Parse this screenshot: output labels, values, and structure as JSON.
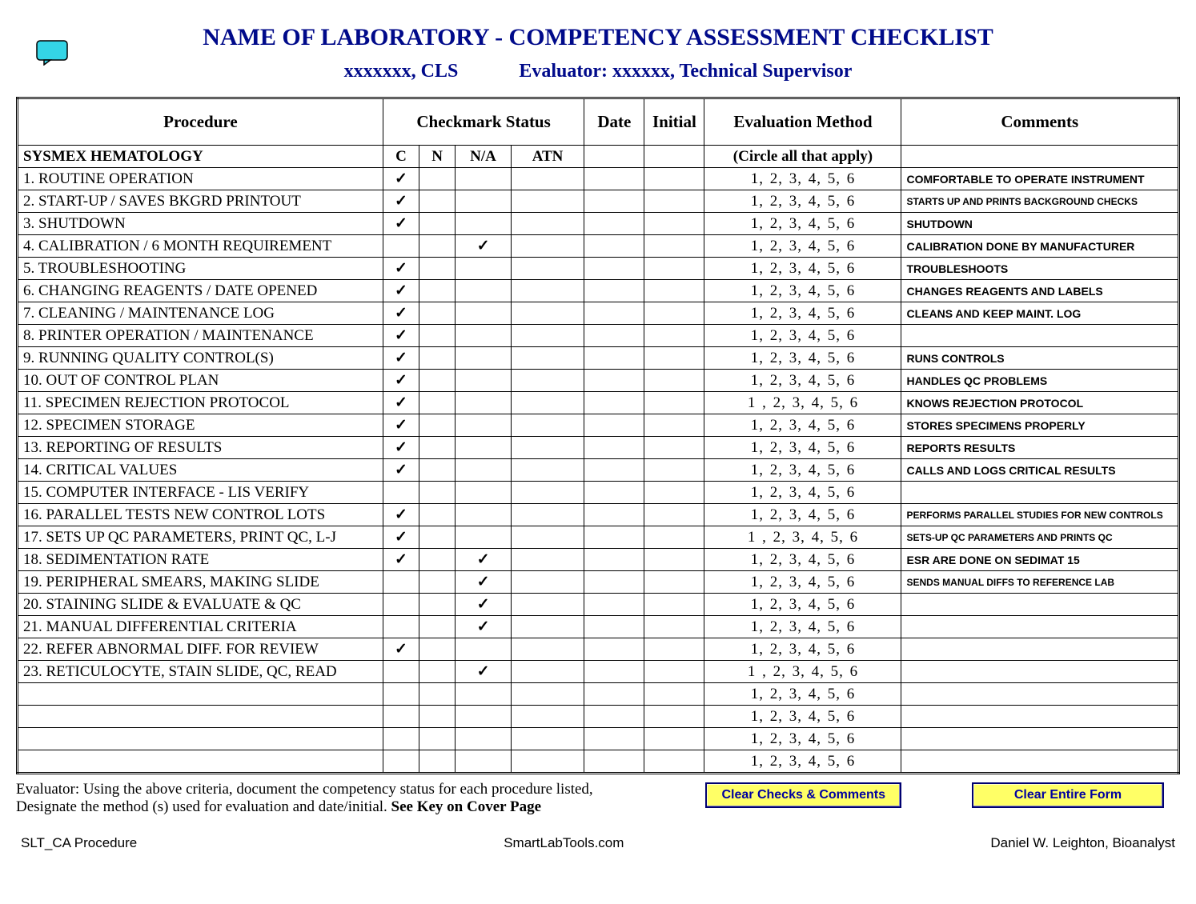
{
  "title": "NAME OF LABORATORY - COMPETENCY ASSESSMENT CHECKLIST",
  "subtitle": {
    "person": "xxxxxxx, CLS",
    "evaluator": "Evaluator: xxxxxx, Technical Supervisor"
  },
  "columns": {
    "procedure": "Procedure",
    "checkmark_status": "Checkmark Status",
    "date": "Date",
    "initial": "Initial",
    "eval_method": "Evaluation Method",
    "comments": "Comments"
  },
  "subheader": {
    "procedure": "SYSMEX HEMATOLOGY",
    "c": "C",
    "n": "N",
    "na": "N/A",
    "atn": "ATN",
    "eval": "(Circle all that apply)"
  },
  "eval_numbers": "1,   2,   3,   4,   5,   6",
  "eval_numbers_spaced": "1 ,  2,   3,   4,   5,   6",
  "rows": [
    {
      "proc": "1.   ROUTINE OPERATION",
      "c": "✓",
      "n": "",
      "na": "",
      "atn": "",
      "comm": "COMFORTABLE TO OPERATE INSTRUMENT"
    },
    {
      "proc": "2.   START-UP / SAVES BKGRD PRINTOUT",
      "c": "✓",
      "n": "",
      "na": "",
      "atn": "",
      "comm": "STARTS UP AND PRINTS BACKGROUND CHECKS",
      "small": true
    },
    {
      "proc": "3.   SHUTDOWN",
      "c": "✓",
      "n": "",
      "na": "",
      "atn": "",
      "comm": "SHUTDOWN"
    },
    {
      "proc": "4.   CALIBRATION / 6 MONTH REQUIREMENT",
      "c": "",
      "n": "",
      "na": "✓",
      "atn": "",
      "comm": "CALIBRATION DONE BY MANUFACTURER"
    },
    {
      "proc": "5.   TROUBLESHOOTING",
      "c": "✓",
      "n": "",
      "na": "",
      "atn": "",
      "comm": "TROUBLESHOOTS"
    },
    {
      "proc": "6.   CHANGING REAGENTS / DATE OPENED",
      "c": "✓",
      "n": "",
      "na": "",
      "atn": "",
      "comm": "CHANGES REAGENTS AND LABELS"
    },
    {
      "proc": "7.   CLEANING / MAINTENANCE LOG",
      "c": "✓",
      "n": "",
      "na": "",
      "atn": "",
      "comm": "CLEANS AND KEEP MAINT. LOG"
    },
    {
      "proc": "8.   PRINTER OPERATION / MAINTENANCE",
      "c": "✓",
      "n": "",
      "na": "",
      "atn": "",
      "comm": ""
    },
    {
      "proc": "9.   RUNNING QUALITY CONTROL(S)",
      "c": "✓",
      "n": "",
      "na": "",
      "atn": "",
      "comm": "RUNS CONTROLS"
    },
    {
      "proc": "10. OUT OF CONTROL PLAN",
      "c": "✓",
      "n": "",
      "na": "",
      "atn": "",
      "comm": "HANDLES QC PROBLEMS"
    },
    {
      "proc": "11. SPECIMEN REJECTION PROTOCOL",
      "c": "✓",
      "n": "",
      "na": "",
      "atn": "",
      "comm": "KNOWS REJECTION PROTOCOL",
      "evalspaced": true
    },
    {
      "proc": "12. SPECIMEN STORAGE",
      "c": "✓",
      "n": "",
      "na": "",
      "atn": "",
      "comm": "STORES SPECIMENS PROPERLY"
    },
    {
      "proc": "13. REPORTING OF RESULTS",
      "c": "✓",
      "n": "",
      "na": "",
      "atn": "",
      "comm": "REPORTS RESULTS"
    },
    {
      "proc": "14. CRITICAL VALUES",
      "c": "✓",
      "n": "",
      "na": "",
      "atn": "",
      "comm": "CALLS AND LOGS CRITICAL RESULTS"
    },
    {
      "proc": "15. COMPUTER INTERFACE - LIS VERIFY",
      "c": "",
      "n": "",
      "na": "",
      "atn": "",
      "comm": ""
    },
    {
      "proc": "16. PARALLEL TESTS NEW CONTROL LOTS",
      "c": "✓",
      "n": "",
      "na": "",
      "atn": "",
      "comm": "PERFORMS PARALLEL STUDIES FOR NEW CONTROLS",
      "small": true
    },
    {
      "proc": "17. SETS UP QC PARAMETERS, PRINT QC, L-J",
      "c": "✓",
      "n": "",
      "na": "",
      "atn": "",
      "comm": "SETS-UP QC PARAMETERS AND PRINTS QC",
      "evalspaced": true,
      "small": true
    },
    {
      "proc": "18. SEDIMENTATION RATE",
      "c": "✓",
      "n": "",
      "na": "✓",
      "atn": "",
      "comm": "ESR ARE DONE ON SEDIMAT 15"
    },
    {
      "proc": "19. PERIPHERAL SMEARS, MAKING SLIDE",
      "c": "",
      "n": "",
      "na": "✓",
      "atn": "",
      "comm": "SENDS MANUAL DIFFS TO REFERENCE LAB",
      "small": true
    },
    {
      "proc": "20. STAINING SLIDE & EVALUATE & QC",
      "c": "",
      "n": "",
      "na": "✓",
      "atn": "",
      "comm": ""
    },
    {
      "proc": "21. MANUAL DIFFERENTIAL CRITERIA",
      "c": "",
      "n": "",
      "na": "✓",
      "atn": "",
      "comm": ""
    },
    {
      "proc": "22. REFER ABNORMAL DIFF. FOR REVIEW",
      "c": "✓",
      "n": "",
      "na": "",
      "atn": "",
      "comm": ""
    },
    {
      "proc": "23. RETICULOCYTE, STAIN SLIDE, QC, READ",
      "c": "",
      "n": "",
      "na": "✓",
      "atn": "",
      "comm": "",
      "evalspaced": true
    },
    {
      "proc": "",
      "c": "",
      "n": "",
      "na": "",
      "atn": "",
      "comm": ""
    },
    {
      "proc": "",
      "c": "",
      "n": "",
      "na": "",
      "atn": "",
      "comm": ""
    },
    {
      "proc": "",
      "c": "",
      "n": "",
      "na": "",
      "atn": "",
      "comm": ""
    },
    {
      "proc": "",
      "c": "",
      "n": "",
      "na": "",
      "atn": "",
      "comm": ""
    }
  ],
  "instructions": {
    "line1": "Evaluator: Using the above criteria, document the competency status for each procedure listed,",
    "line2a": "Designate the method (s) used for evaluation and date/initial.  ",
    "line2b": "See Key on Cover Page"
  },
  "buttons": {
    "clear_checks": "Clear Checks & Comments",
    "clear_form": "Clear Entire Form"
  },
  "footer": {
    "left": "SLT_CA Procedure",
    "center": "SmartLabTools.com",
    "right": "Daniel W. Leighton, Bioanalyst"
  }
}
